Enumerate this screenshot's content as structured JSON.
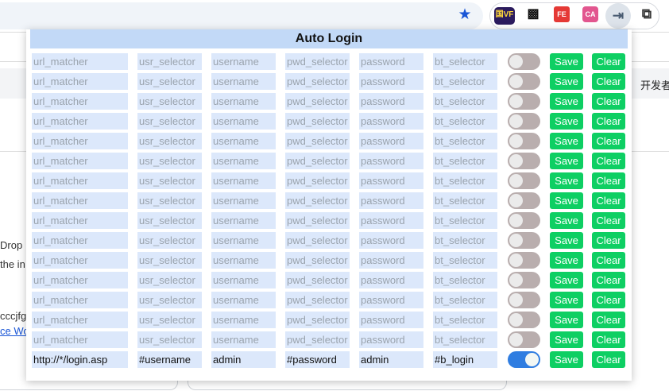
{
  "browser": {
    "extensions": [
      {
        "name": "vf-extension",
        "label": "国VF"
      },
      {
        "name": "game-extension",
        "label": "▩"
      },
      {
        "name": "fe-extension",
        "label": "FE"
      },
      {
        "name": "ca-extension",
        "label": "CA"
      },
      {
        "name": "auto-login-extension",
        "label": "⇥"
      },
      {
        "name": "extensions-puzzle",
        "label": "⧉"
      }
    ],
    "bookmark_star": "★"
  },
  "background_page": {
    "right_text": "开发者",
    "left_lines": [
      "Drop",
      "the in",
      "cccjfg",
      "ce Wo"
    ]
  },
  "popup": {
    "title": "Auto Login",
    "placeholders": {
      "url_matcher": "url_matcher",
      "usr_selector": "usr_selector",
      "username": "username",
      "pwd_selector": "pwd_selector",
      "password": "password",
      "bt_selector": "bt_selector"
    },
    "save_label": "Save",
    "clear_label": "Clear",
    "rows": [
      {
        "url_matcher": "",
        "usr_selector": "",
        "username": "",
        "pwd_selector": "",
        "password": "",
        "bt_selector": "",
        "enabled": false
      },
      {
        "url_matcher": "",
        "usr_selector": "",
        "username": "",
        "pwd_selector": "",
        "password": "",
        "bt_selector": "",
        "enabled": false
      },
      {
        "url_matcher": "",
        "usr_selector": "",
        "username": "",
        "pwd_selector": "",
        "password": "",
        "bt_selector": "",
        "enabled": false
      },
      {
        "url_matcher": "",
        "usr_selector": "",
        "username": "",
        "pwd_selector": "",
        "password": "",
        "bt_selector": "",
        "enabled": false
      },
      {
        "url_matcher": "",
        "usr_selector": "",
        "username": "",
        "pwd_selector": "",
        "password": "",
        "bt_selector": "",
        "enabled": false
      },
      {
        "url_matcher": "",
        "usr_selector": "",
        "username": "",
        "pwd_selector": "",
        "password": "",
        "bt_selector": "",
        "enabled": false
      },
      {
        "url_matcher": "",
        "usr_selector": "",
        "username": "",
        "pwd_selector": "",
        "password": "",
        "bt_selector": "",
        "enabled": false
      },
      {
        "url_matcher": "",
        "usr_selector": "",
        "username": "",
        "pwd_selector": "",
        "password": "",
        "bt_selector": "",
        "enabled": false
      },
      {
        "url_matcher": "",
        "usr_selector": "",
        "username": "",
        "pwd_selector": "",
        "password": "",
        "bt_selector": "",
        "enabled": false
      },
      {
        "url_matcher": "",
        "usr_selector": "",
        "username": "",
        "pwd_selector": "",
        "password": "",
        "bt_selector": "",
        "enabled": false
      },
      {
        "url_matcher": "",
        "usr_selector": "",
        "username": "",
        "pwd_selector": "",
        "password": "",
        "bt_selector": "",
        "enabled": false
      },
      {
        "url_matcher": "",
        "usr_selector": "",
        "username": "",
        "pwd_selector": "",
        "password": "",
        "bt_selector": "",
        "enabled": false
      },
      {
        "url_matcher": "",
        "usr_selector": "",
        "username": "",
        "pwd_selector": "",
        "password": "",
        "bt_selector": "",
        "enabled": false
      },
      {
        "url_matcher": "",
        "usr_selector": "",
        "username": "",
        "pwd_selector": "",
        "password": "",
        "bt_selector": "",
        "enabled": false
      },
      {
        "url_matcher": "",
        "usr_selector": "",
        "username": "",
        "pwd_selector": "",
        "password": "",
        "bt_selector": "",
        "enabled": false
      },
      {
        "url_matcher": "http://*/login.asp",
        "usr_selector": "#username",
        "username": "admin",
        "pwd_selector": "#password",
        "password": "admin",
        "bt_selector": "#b_login",
        "enabled": true
      }
    ]
  },
  "colors": {
    "field_bg": "#dce8fb",
    "title_bg": "#c2d9f7",
    "button_green": "#0ecf63",
    "toggle_off": "#b9aeae",
    "toggle_on": "#2f7de1"
  }
}
